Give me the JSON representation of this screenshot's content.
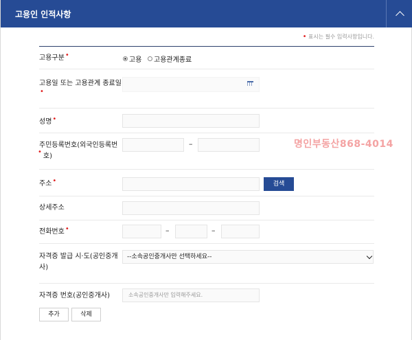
{
  "header": {
    "title": "고용인 인적사항"
  },
  "required_note": {
    "dot": "•",
    "text": "표시는 필수 입력사항입니다."
  },
  "fields": {
    "employment_type": {
      "label": "고용구분",
      "options": [
        "고용",
        "고용관계종료"
      ],
      "selected": "고용"
    },
    "date": {
      "label_line1": "고용일 또는 고용관계 종료일"
    },
    "name": {
      "label": "성명"
    },
    "resident_number": {
      "label_line1": "주민등록번호(외국인등록번",
      "label_line2": "호)"
    },
    "address": {
      "label": "주소",
      "search_button": "검색"
    },
    "address_detail": {
      "label": "상세주소"
    },
    "phone": {
      "label": "전화번호"
    },
    "license_region": {
      "label_line1": "자격증 발급 시·도(공인중개",
      "label_line2": "사)",
      "selected": "--소속공인중개사만 선택하세요--"
    },
    "license_number": {
      "label": "자격증 번호(공인중개사)",
      "placeholder": "소속공인중개사만 입력해주세요."
    }
  },
  "buttons": {
    "add": "추가",
    "delete": "삭제"
  },
  "watermark": "명인부동산868-4014",
  "required_mark": "•",
  "dash": "–",
  "colors": {
    "header": "#264b95",
    "required": "#e02020",
    "watermark": "#f4a3a3"
  }
}
